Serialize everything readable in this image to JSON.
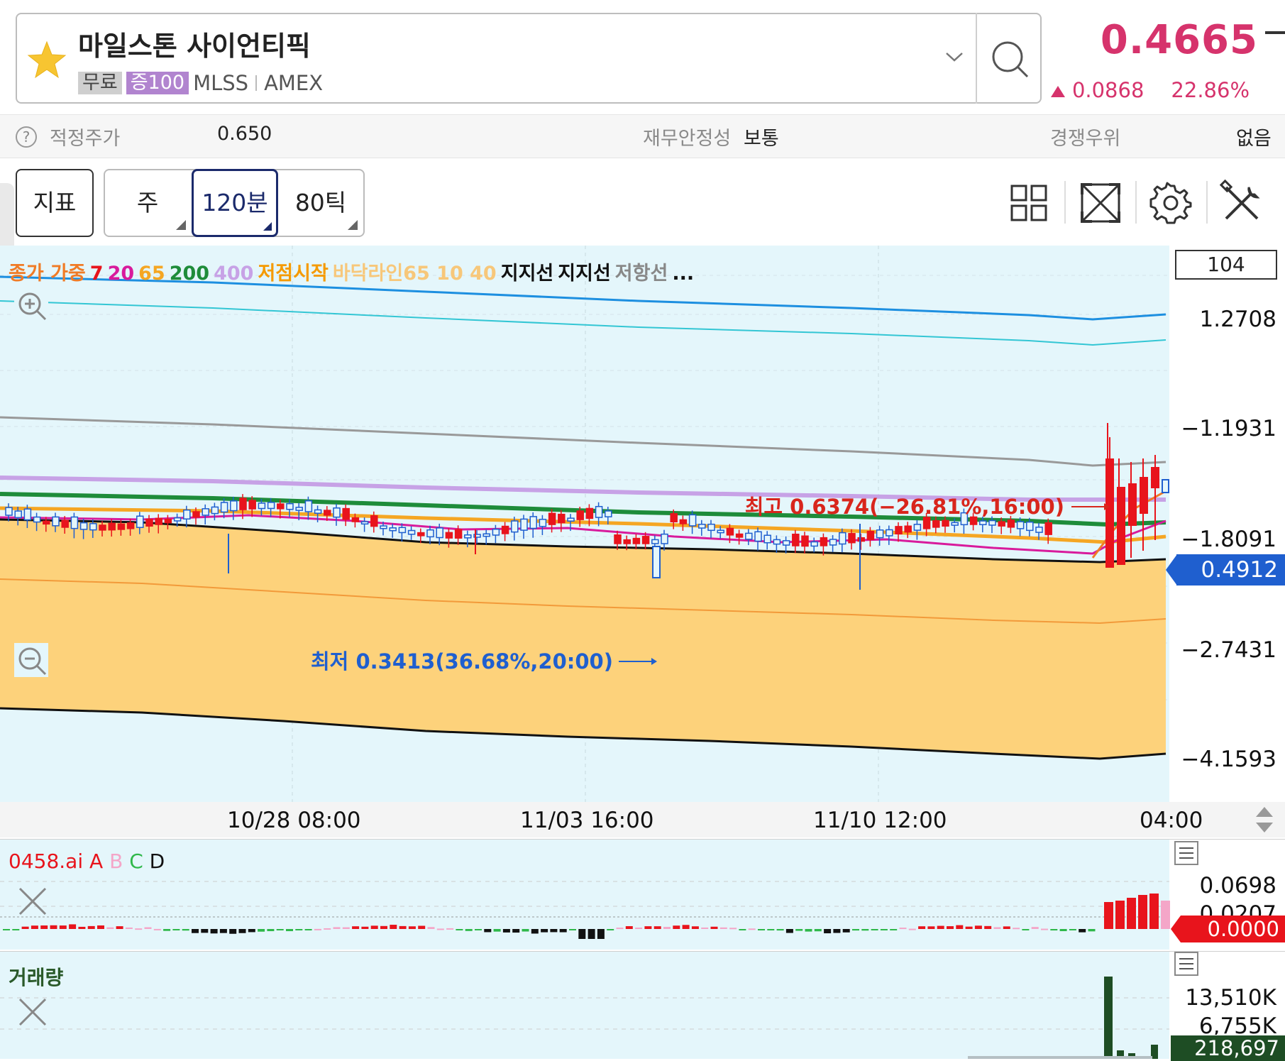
{
  "header": {
    "stock_name": "마일스톤 사이언티픽",
    "tag_free": "무료",
    "tag_margin": "증100",
    "ticker": "MLSS",
    "exchange": "AMEX",
    "price": "0.4665",
    "change": "0.0868",
    "change_pct": "22.86%",
    "price_color": "#d6336c"
  },
  "info_bar": {
    "fair_price_label": "적정주가",
    "fair_price_value": "0.650",
    "financial_label": "재무안정성",
    "financial_value": "보통",
    "competitive_label": "경쟁우위",
    "competitive_value": "없음"
  },
  "toolbar": {
    "indicator": "지표",
    "week": "주",
    "minute": "120분",
    "tick": "80틱",
    "icons": [
      "grid-icon",
      "expand-icon",
      "gear-icon",
      "tools-icon"
    ]
  },
  "chart": {
    "legend": [
      {
        "text": "종가 가중",
        "color": "#f07b26"
      },
      {
        "text": "7",
        "color": "#e8141c"
      },
      {
        "text": "20",
        "color": "#d81b9c"
      },
      {
        "text": "65",
        "color": "#f5a623"
      },
      {
        "text": "200",
        "color": "#1e8c3a"
      },
      {
        "text": "400",
        "color": "#c7a2e6"
      },
      {
        "text": "저점시작",
        "color": "#f59a00"
      },
      {
        "text": "바닥라인65 10 40",
        "color": "#f7c77a"
      },
      {
        "text": "지지선",
        "color": "#111111"
      },
      {
        "text": "지지선",
        "color": "#111111"
      },
      {
        "text": "저항선",
        "color": "#888888"
      },
      {
        "text": "...",
        "color": "#111111"
      }
    ],
    "scale_value": "104",
    "y_labels": [
      "1.2708",
      "−1.1931",
      "−1.8091",
      "−2.7431",
      "−4.1593"
    ],
    "current_price_tag": "0.4912",
    "high_annotation": "최고 0.6374(−26.81%,16:00)",
    "low_annotation": "최저 0.3413(36.68%,20:00)",
    "x_labels": [
      "10/28 08:00",
      "11/03 16:00",
      "11/10 12:00",
      "04:00"
    ]
  },
  "ai_panel": {
    "title_prefix": "0458.ai",
    "a": "A",
    "b": "B",
    "c": "C",
    "d": "D",
    "y_top": "0.0698",
    "y_mid": "0.0207",
    "zero_tag": "0.0000"
  },
  "volume_panel": {
    "title": "거래량",
    "y_top": "13,510K",
    "y_mid": "6,755K",
    "current_tag": "218,697"
  }
}
